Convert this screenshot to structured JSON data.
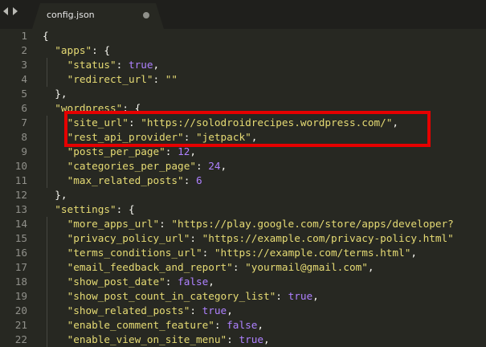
{
  "tab": {
    "title": "config.json"
  },
  "lines": [
    {
      "num": "1",
      "indent": 0,
      "tokens": [
        {
          "t": "p",
          "v": "{"
        }
      ]
    },
    {
      "num": "2",
      "indent": 1,
      "tokens": [
        {
          "t": "s",
          "v": "\"apps\""
        },
        {
          "t": "p",
          "v": ": {"
        }
      ]
    },
    {
      "num": "3",
      "indent": 2,
      "tokens": [
        {
          "t": "s",
          "v": "\"status\""
        },
        {
          "t": "p",
          "v": ": "
        },
        {
          "t": "n",
          "v": "true"
        },
        {
          "t": "p",
          "v": ","
        }
      ]
    },
    {
      "num": "4",
      "indent": 2,
      "tokens": [
        {
          "t": "s",
          "v": "\"redirect_url\""
        },
        {
          "t": "p",
          "v": ": "
        },
        {
          "t": "s",
          "v": "\"\""
        }
      ]
    },
    {
      "num": "5",
      "indent": 1,
      "tokens": [
        {
          "t": "p",
          "v": "},"
        }
      ]
    },
    {
      "num": "6",
      "indent": 1,
      "tokens": [
        {
          "t": "s",
          "v": "\"wordpress\""
        },
        {
          "t": "p",
          "v": ": {"
        }
      ]
    },
    {
      "num": "7",
      "indent": 2,
      "tokens": [
        {
          "t": "s",
          "v": "\"site_url\""
        },
        {
          "t": "p",
          "v": ": "
        },
        {
          "t": "s",
          "v": "\"https://solodroidrecipes.wordpress.com/\""
        },
        {
          "t": "p",
          "v": ","
        }
      ]
    },
    {
      "num": "8",
      "indent": 2,
      "tokens": [
        {
          "t": "s",
          "v": "\"rest_api_provider\""
        },
        {
          "t": "p",
          "v": ": "
        },
        {
          "t": "s",
          "v": "\"jetpack\""
        },
        {
          "t": "p",
          "v": ","
        }
      ]
    },
    {
      "num": "9",
      "indent": 2,
      "tokens": [
        {
          "t": "s",
          "v": "\"posts_per_page\""
        },
        {
          "t": "p",
          "v": ": "
        },
        {
          "t": "n",
          "v": "12"
        },
        {
          "t": "p",
          "v": ","
        }
      ]
    },
    {
      "num": "10",
      "indent": 2,
      "tokens": [
        {
          "t": "s",
          "v": "\"categories_per_page\""
        },
        {
          "t": "p",
          "v": ": "
        },
        {
          "t": "n",
          "v": "24"
        },
        {
          "t": "p",
          "v": ","
        }
      ]
    },
    {
      "num": "11",
      "indent": 2,
      "tokens": [
        {
          "t": "s",
          "v": "\"max_related_posts\""
        },
        {
          "t": "p",
          "v": ": "
        },
        {
          "t": "n",
          "v": "6"
        }
      ]
    },
    {
      "num": "12",
      "indent": 1,
      "tokens": [
        {
          "t": "p",
          "v": "},"
        }
      ]
    },
    {
      "num": "13",
      "indent": 1,
      "tokens": [
        {
          "t": "s",
          "v": "\"settings\""
        },
        {
          "t": "p",
          "v": ": {"
        }
      ]
    },
    {
      "num": "14",
      "indent": 2,
      "tokens": [
        {
          "t": "s",
          "v": "\"more_apps_url\""
        },
        {
          "t": "p",
          "v": ": "
        },
        {
          "t": "s",
          "v": "\"https://play.google.com/store/apps/developer?"
        }
      ]
    },
    {
      "num": "15",
      "indent": 2,
      "tokens": [
        {
          "t": "s",
          "v": "\"privacy_policy_url\""
        },
        {
          "t": "p",
          "v": ": "
        },
        {
          "t": "s",
          "v": "\"https://example.com/privacy-policy.html\""
        }
      ]
    },
    {
      "num": "16",
      "indent": 2,
      "tokens": [
        {
          "t": "s",
          "v": "\"terms_conditions_url\""
        },
        {
          "t": "p",
          "v": ": "
        },
        {
          "t": "s",
          "v": "\"https://example.com/terms.html\""
        },
        {
          "t": "p",
          "v": ","
        }
      ]
    },
    {
      "num": "17",
      "indent": 2,
      "tokens": [
        {
          "t": "s",
          "v": "\"email_feedback_and_report\""
        },
        {
          "t": "p",
          "v": ": "
        },
        {
          "t": "s",
          "v": "\"yourmail@gmail.com\""
        },
        {
          "t": "p",
          "v": ","
        }
      ]
    },
    {
      "num": "18",
      "indent": 2,
      "tokens": [
        {
          "t": "s",
          "v": "\"show_post_date\""
        },
        {
          "t": "p",
          "v": ": "
        },
        {
          "t": "n",
          "v": "false"
        },
        {
          "t": "p",
          "v": ","
        }
      ]
    },
    {
      "num": "19",
      "indent": 2,
      "tokens": [
        {
          "t": "s",
          "v": "\"show_post_count_in_category_list\""
        },
        {
          "t": "p",
          "v": ": "
        },
        {
          "t": "n",
          "v": "true"
        },
        {
          "t": "p",
          "v": ","
        }
      ]
    },
    {
      "num": "20",
      "indent": 2,
      "tokens": [
        {
          "t": "s",
          "v": "\"show_related_posts\""
        },
        {
          "t": "p",
          "v": ": "
        },
        {
          "t": "n",
          "v": "true"
        },
        {
          "t": "p",
          "v": ","
        }
      ]
    },
    {
      "num": "21",
      "indent": 2,
      "tokens": [
        {
          "t": "s",
          "v": "\"enable_comment_feature\""
        },
        {
          "t": "p",
          "v": ": "
        },
        {
          "t": "n",
          "v": "false"
        },
        {
          "t": "p",
          "v": ","
        }
      ]
    },
    {
      "num": "22",
      "indent": 2,
      "tokens": [
        {
          "t": "s",
          "v": "\"enable_view_on_site_menu\""
        },
        {
          "t": "p",
          "v": ": "
        },
        {
          "t": "n",
          "v": "true"
        },
        {
          "t": "p",
          "v": ","
        }
      ]
    }
  ],
  "highlight": {
    "lines": [
      "7",
      "8"
    ],
    "color": "#e60000"
  },
  "colors": {
    "background": "#272822",
    "string": "#e6db74",
    "constant": "#ae81ff",
    "punctuation": "#f8f8f2",
    "line_number": "#90908a"
  }
}
